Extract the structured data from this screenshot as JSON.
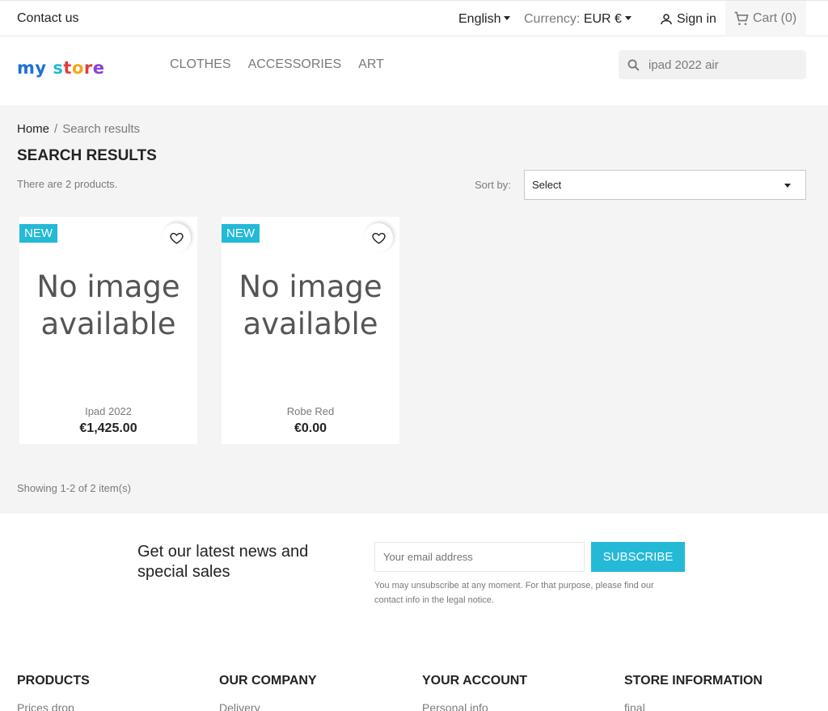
{
  "topbar": {
    "contact": "Contact us",
    "language": "English",
    "currency_label": "Currency:",
    "currency_value": "EUR €",
    "signin": "Sign in",
    "cart": "Cart (0)"
  },
  "header": {
    "logo": {
      "my": "my",
      "s": "s",
      "t": "t",
      "o": "o",
      "r": "r",
      "e": "e"
    },
    "menu": [
      "Clothes",
      "Accessories",
      "Art"
    ],
    "search_value": "ipad 2022 air"
  },
  "main": {
    "breadcrumb": {
      "home": "Home",
      "separator": "/",
      "current": "Search results"
    },
    "title": "Search results",
    "count": "There are 2 products.",
    "sort_label": "Sort by:",
    "sort_value": "Select",
    "products": [
      {
        "flag": "New",
        "image_text_1": "No image",
        "image_text_2": "available",
        "name": "Ipad 2022",
        "price": "€1,425.00"
      },
      {
        "flag": "New",
        "image_text_1": "No image",
        "image_text_2": "available",
        "name": "Robe Red",
        "price": "€0.00"
      }
    ],
    "showing": "Showing 1-2 of 2 item(s)"
  },
  "newsletter": {
    "title": "Get our latest news and special sales",
    "placeholder": "Your email address",
    "button": "Subscribe",
    "note": "You may unsubscribe at any moment. For that purpose, please find our contact info in the legal notice."
  },
  "footer": {
    "columns": [
      {
        "title": "Products",
        "link": "Prices drop"
      },
      {
        "title": "Our company",
        "link": "Delivery"
      },
      {
        "title": "Your account",
        "link": "Personal info"
      },
      {
        "title": "Store information",
        "link": "final"
      }
    ]
  },
  "colors": {
    "accent": "#24b9d7",
    "text": "#232323",
    "muted": "#7a7a7a",
    "bg": "#f4f4f4"
  },
  "icons": [
    "person-icon",
    "cart-icon",
    "search-icon",
    "heart-icon",
    "caret-down-icon"
  ]
}
